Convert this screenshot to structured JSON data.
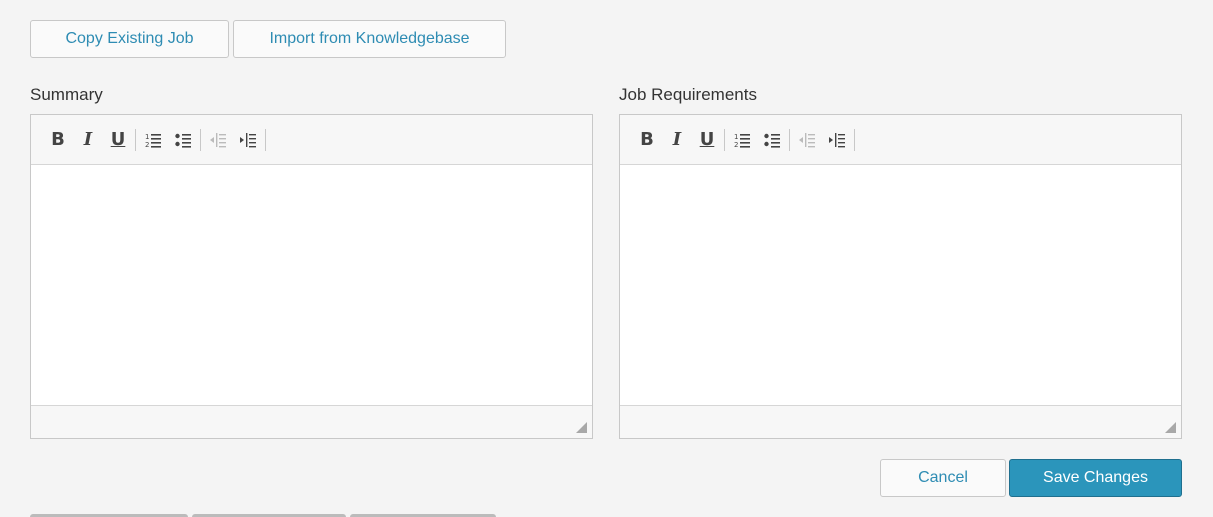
{
  "actions": {
    "copy_label": "Copy Existing Job",
    "import_label": "Import from Knowledgebase"
  },
  "editors": [
    {
      "label": "Summary"
    },
    {
      "label": "Job Requirements"
    }
  ],
  "toolbar": {
    "bold": "B",
    "italic": "I",
    "underline": "U",
    "icons": [
      "bold-icon",
      "italic-icon",
      "underline-icon",
      "numbered-list-icon",
      "bullet-list-icon",
      "outdent-icon",
      "indent-icon"
    ]
  },
  "footer": {
    "cancel_label": "Cancel",
    "save_label": "Save Changes"
  },
  "colors": {
    "link": "#2e8cb3",
    "primary": "#2b95bb",
    "background": "#f4f4f4"
  }
}
